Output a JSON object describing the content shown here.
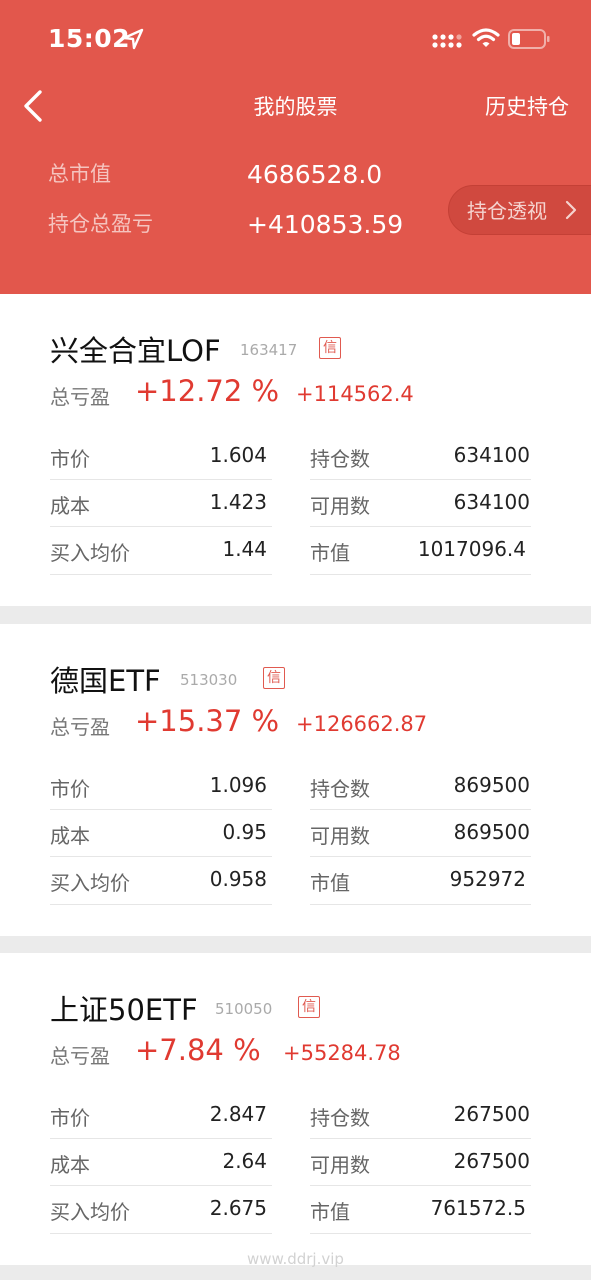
{
  "status_bar": {
    "time": "15:02"
  },
  "nav": {
    "title": "我的股票",
    "right_link": "历史持仓"
  },
  "summary": {
    "market_value_label": "总市值",
    "market_value": "4686528.0",
    "total_pl_label": "持仓总盈亏",
    "total_pl": "+410853.59",
    "insight_button": "持仓透视"
  },
  "labels": {
    "pl": "总亏盈",
    "price": "市价",
    "cost": "成本",
    "avg_buy": "买入均价",
    "shares": "持仓数",
    "available": "可用数",
    "market_value": "市值",
    "badge": "信"
  },
  "stocks": [
    {
      "name": "兴全合宜LOF",
      "code": "163417",
      "pl_pct": "+12.72 %",
      "pl_amount": "+114562.4",
      "price": "1.604",
      "cost": "1.423",
      "avg_buy": "1.44",
      "shares": "634100",
      "available": "634100",
      "market_value": "1017096.4"
    },
    {
      "name": "德国ETF",
      "code": "513030",
      "pl_pct": "+15.37 %",
      "pl_amount": "+126662.87",
      "price": "1.096",
      "cost": "0.95",
      "avg_buy": "0.958",
      "shares": "869500",
      "available": "869500",
      "market_value": "952972"
    },
    {
      "name": "上证50ETF",
      "code": "510050",
      "pl_pct": "+7.84 %",
      "pl_amount": "+55284.78",
      "price": "2.847",
      "cost": "2.64",
      "avg_buy": "2.675",
      "shares": "267500",
      "available": "267500",
      "market_value": "761572.5"
    }
  ],
  "watermark": "www.ddrj.vip",
  "colors": {
    "header": "#e2574c",
    "gain": "#e03a31"
  }
}
